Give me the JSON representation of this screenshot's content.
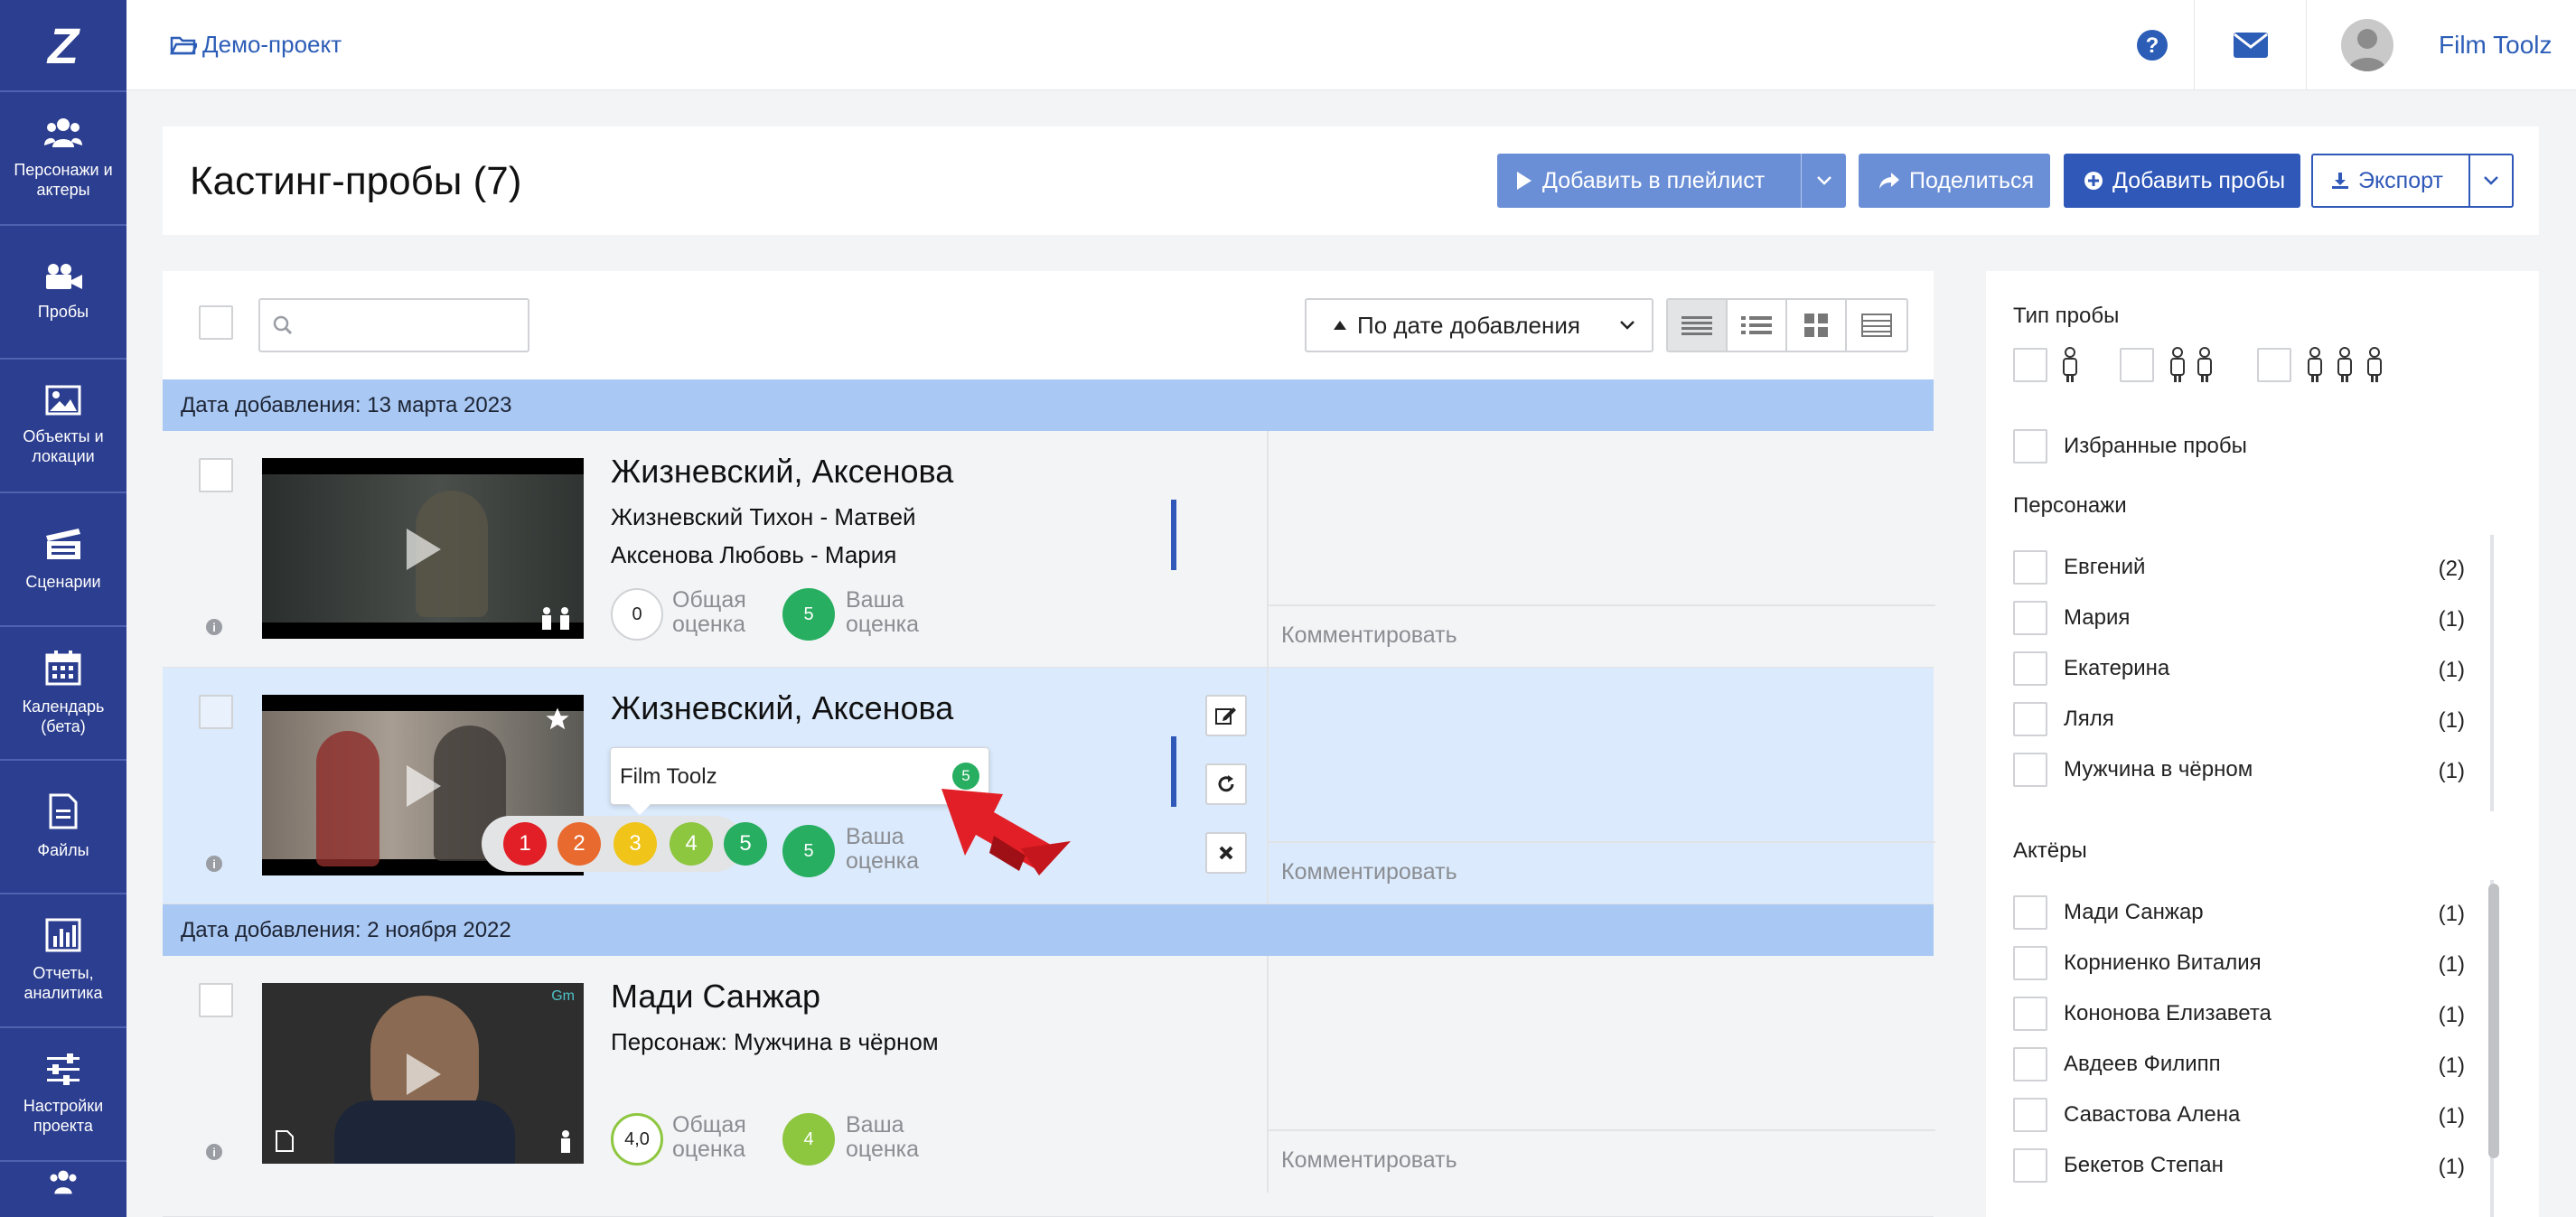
{
  "sidebar": {
    "items": [
      {
        "label": "Персонажи и актеры"
      },
      {
        "label": "Пробы"
      },
      {
        "label": "Объекты и локации"
      },
      {
        "label": "Сценарии"
      },
      {
        "label": "Календарь (бета)"
      },
      {
        "label": "Файлы"
      },
      {
        "label": "Отчеты, аналитика"
      },
      {
        "label": "Настройки проекта"
      }
    ]
  },
  "topbar": {
    "project": "Демо-проект",
    "user": "Film Toolz"
  },
  "header": {
    "title": "Кастинг-пробы (7)",
    "add_playlist": "Добавить в плейлист",
    "share": "Поделиться",
    "add_tests": "Добавить пробы",
    "export": "Экспорт"
  },
  "toolbar": {
    "sort": "По дате добавления",
    "search_placeholder": ""
  },
  "groups": [
    {
      "date": "Дата добавления: 13 марта 2023"
    },
    {
      "date": "Дата добавления: 2 ноября 2022"
    }
  ],
  "rows": [
    {
      "name": "Жизневский, Аксенова",
      "line1": "Жизневский Тихон - Матвей",
      "line2": "Аксенова Любовь - Мария",
      "total": "0",
      "total_label": "Общая оценка",
      "yours": "5",
      "yours_label": "Ваша оценка",
      "comment": "Комментировать"
    },
    {
      "name": "Жизневский, Аксенова",
      "tooltip_user": "Film Toolz",
      "tooltip_score": "5",
      "picker": [
        "1",
        "2",
        "3",
        "4",
        "5"
      ],
      "yours": "5",
      "yours_label": "Ваша оценка",
      "comment": "Комментировать"
    },
    {
      "name": "Мади Санжар",
      "line1": "Персонаж: Мужчина в чёрном",
      "total": "4,0",
      "total_label": "Общая оценка",
      "yours": "4",
      "yours_label": "Ваша оценка",
      "comment": "Комментировать"
    }
  ],
  "filters": {
    "type_title": "Тип пробы",
    "favorites": "Избранные пробы",
    "characters_title": "Персонажи",
    "characters": [
      {
        "name": "Евгений",
        "count": "(2)"
      },
      {
        "name": "Мария",
        "count": "(1)"
      },
      {
        "name": "Екатерина",
        "count": "(1)"
      },
      {
        "name": "Ляля",
        "count": "(1)"
      },
      {
        "name": "Мужчина в чёрном",
        "count": "(1)"
      }
    ],
    "actors_title": "Актёры",
    "actors": [
      {
        "name": "Мади Санжар",
        "count": "(1)"
      },
      {
        "name": "Корниенко Виталия",
        "count": "(1)"
      },
      {
        "name": "Кононова Елизавета",
        "count": "(1)"
      },
      {
        "name": "Авдеев Филипп",
        "count": "(1)"
      },
      {
        "name": "Савастова Алена",
        "count": "(1)"
      },
      {
        "name": "Бекетов Степан",
        "count": "(1)"
      }
    ]
  },
  "colors": {
    "sidebar": "#2c3e8f",
    "primary": "#2f58b8",
    "light_button": "#6b8fd6",
    "group": "#a9c8f3",
    "green": "#27ae60"
  }
}
